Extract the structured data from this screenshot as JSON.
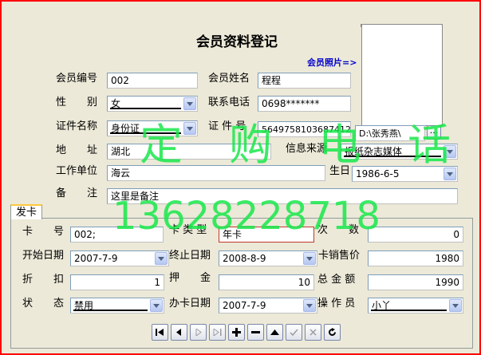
{
  "form": {
    "title": "会员资料登记",
    "photo_label": "会员照片=>",
    "member_no_label": "会员编号",
    "member_no": "002",
    "member_name_label": "会员姓名",
    "member_name": "程程",
    "gender_label": "性　　别",
    "gender": "女",
    "phone_label": "联系电话",
    "phone": "0698*******",
    "id_type_label": "证件名称",
    "id_type": "身份证",
    "id_no_label": "证 件 号",
    "id_no": "56497581036874123",
    "photo_path": "D:\\张秀燕\\",
    "browse_label": "...",
    "address_label": "地　　址",
    "address": "湖北",
    "info_source_label": "信息来源",
    "info_source": "报纸杂志媒体",
    "workplace_label": "工作单位",
    "workplace": "海云",
    "birthday_label": "生日",
    "birthday": "1986-6-5",
    "remark_label": "备　　注",
    "remark": "这里是备注"
  },
  "card": {
    "tab_label": "发卡",
    "card_no_label": "卡　　号",
    "card_no": "002;",
    "card_type_label": "卡 类 型",
    "card_type": "年卡",
    "times_label": "次　　数",
    "times": "0",
    "start_date_label": "开始日期",
    "start_date": "2007-7-9",
    "end_date_label": "终止日期",
    "end_date": "2008-8-9",
    "card_price_label": "卡销售价",
    "card_price": "1980",
    "discount_label": "折　　扣",
    "discount": "1",
    "deposit_label": "押　　金",
    "deposit": "10",
    "total_label": "总 金 额",
    "total": "1990",
    "status_label": "状　　态",
    "status": "禁用",
    "issue_date_label": "办卡日期",
    "issue_date": "2007-7-9",
    "operator_label": "操 作 员",
    "operator": "小丫"
  },
  "watermark": {
    "line1": "定　购　电　话",
    "line2": "13628228718"
  },
  "colors": {
    "accent": "#ffc83c",
    "watermark": "#18e84a",
    "photo_label": "#0000cc",
    "border": "#ff0000"
  }
}
